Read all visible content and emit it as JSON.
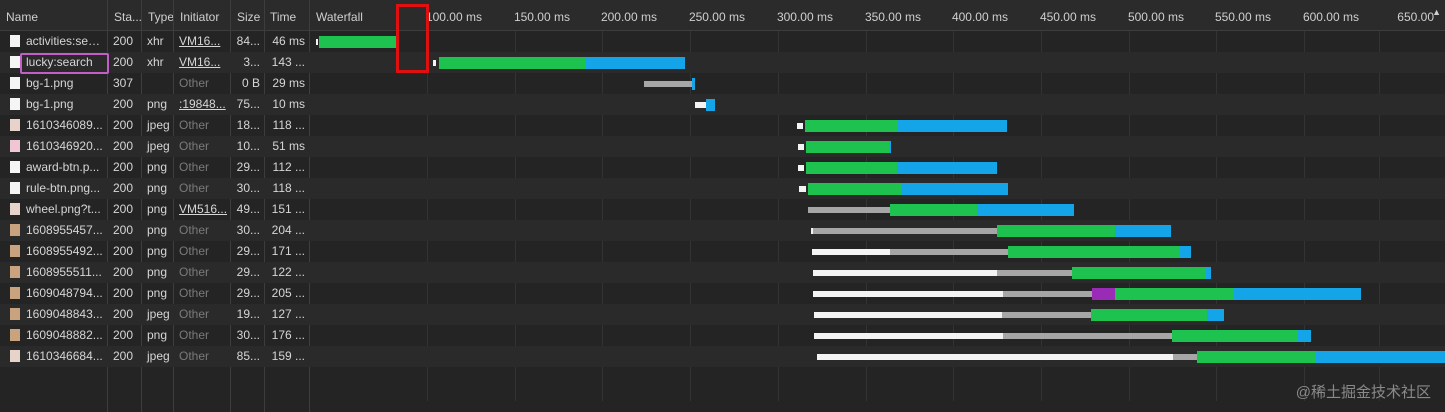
{
  "headers": {
    "name": "Name",
    "status": "Sta...",
    "type": "Type",
    "initiator": "Initiator",
    "size": "Size",
    "time": "Time",
    "waterfall": "Waterfall"
  },
  "ticks": [
    "100.00 ms",
    "150.00 ms",
    "200.00 ms",
    "250.00 ms",
    "300.00 ms",
    "350.00 ms",
    "400.00 ms",
    "450.00 ms",
    "500.00 ms",
    "550.00 ms",
    "600.00 ms",
    "650.00"
  ],
  "colors": {
    "green": "#1dc24f",
    "blue": "#14a4e8",
    "gray": "#a6a6a6",
    "white": "#f4f4f4",
    "purple": "#9a2bb6",
    "highlight_red": "#e01010",
    "highlight_pink": "#c45ec7"
  },
  "rows": [
    {
      "name": "activities:sea...",
      "status": "200",
      "type": "xhr",
      "initiator": "VM16...",
      "initiator_link": true,
      "size": "84...",
      "time": "46 ms",
      "icon": "file-icon",
      "bars": [
        [
          "white",
          316,
          318
        ],
        [
          "green",
          319,
          396
        ]
      ]
    },
    {
      "name": "lucky:search",
      "status": "200",
      "type": "xhr",
      "initiator": "VM16...",
      "initiator_link": true,
      "size": "3...",
      "time": "143 ...",
      "icon": "file-icon",
      "bars": [
        [
          "white",
          433,
          436
        ],
        [
          "green",
          439,
          586
        ],
        [
          "blue",
          586,
          685
        ]
      ]
    },
    {
      "name": "bg-1.png",
      "status": "307",
      "type": "",
      "initiator": "Other",
      "initiator_link": false,
      "size": "0 B",
      "time": "29 ms",
      "icon": "file-icon",
      "bars": [
        [
          "gray",
          644,
          692
        ],
        [
          "blue",
          692,
          695
        ]
      ]
    },
    {
      "name": "bg-1.png",
      "status": "200",
      "type": "png",
      "initiator": ":19848...",
      "initiator_link": true,
      "size": "75...",
      "time": "10 ms",
      "icon": "file-icon",
      "bars": [
        [
          "white",
          695,
          706
        ],
        [
          "blue",
          706,
          715
        ]
      ]
    },
    {
      "name": "1610346089...",
      "status": "200",
      "type": "jpeg",
      "initiator": "Other",
      "initiator_link": false,
      "size": "18...",
      "time": "118 ...",
      "icon": "image-icon",
      "bars": [
        [
          "white",
          797,
          803
        ],
        [
          "green",
          805,
          898
        ],
        [
          "blue",
          898,
          1007
        ]
      ]
    },
    {
      "name": "1610346920...",
      "status": "200",
      "type": "jpeg",
      "initiator": "Other",
      "initiator_link": false,
      "size": "10...",
      "time": "51 ms",
      "icon": "pink-image-icon",
      "bars": [
        [
          "white",
          798,
          804
        ],
        [
          "green",
          806,
          889
        ],
        [
          "blue",
          889,
          891
        ]
      ]
    },
    {
      "name": "award-btn.p...",
      "status": "200",
      "type": "png",
      "initiator": "Other",
      "initiator_link": false,
      "size": "29...",
      "time": "112 ...",
      "icon": "file-icon",
      "bars": [
        [
          "white",
          798,
          804
        ],
        [
          "green",
          806,
          897
        ],
        [
          "blue",
          897,
          997
        ]
      ]
    },
    {
      "name": "rule-btn.png...",
      "status": "200",
      "type": "png",
      "initiator": "Other",
      "initiator_link": false,
      "size": "30...",
      "time": "118 ...",
      "icon": "file-icon",
      "bars": [
        [
          "white",
          799,
          806
        ],
        [
          "green",
          808,
          901
        ],
        [
          "blue",
          901,
          1008
        ]
      ]
    },
    {
      "name": "wheel.png?t...",
      "status": "200",
      "type": "png",
      "initiator": "VM516...",
      "initiator_link": true,
      "size": "49...",
      "time": "151 ...",
      "icon": "image-icon",
      "bars": [
        [
          "gray",
          808,
          890
        ],
        [
          "green",
          890,
          977
        ],
        [
          "blue",
          977,
          1074
        ]
      ]
    },
    {
      "name": "1608955457...",
      "status": "200",
      "type": "png",
      "initiator": "Other",
      "initiator_link": false,
      "size": "30...",
      "time": "204 ...",
      "icon": "photo-icon",
      "bars": [
        [
          "white",
          811,
          813
        ],
        [
          "gray",
          813,
          997
        ],
        [
          "green",
          997,
          1115
        ],
        [
          "blue",
          1115,
          1171
        ]
      ]
    },
    {
      "name": "1608955492...",
      "status": "200",
      "type": "png",
      "initiator": "Other",
      "initiator_link": false,
      "size": "29...",
      "time": "171 ...",
      "icon": "photo-icon",
      "bars": [
        [
          "white",
          812,
          890
        ],
        [
          "gray",
          890,
          1008
        ],
        [
          "green",
          1008,
          1180
        ],
        [
          "blue",
          1180,
          1191
        ]
      ]
    },
    {
      "name": "1608955511...",
      "status": "200",
      "type": "png",
      "initiator": "Other",
      "initiator_link": false,
      "size": "29...",
      "time": "122 ...",
      "icon": "photo-icon",
      "bars": [
        [
          "white",
          813,
          997
        ],
        [
          "gray",
          997,
          1072
        ],
        [
          "green",
          1072,
          1206
        ],
        [
          "blue",
          1206,
          1211
        ]
      ]
    },
    {
      "name": "1609048794...",
      "status": "200",
      "type": "png",
      "initiator": "Other",
      "initiator_link": false,
      "size": "29...",
      "time": "205 ...",
      "icon": "photo-icon",
      "bars": [
        [
          "white",
          813,
          1003
        ],
        [
          "gray",
          1003,
          1092
        ],
        [
          "purple",
          1092,
          1115
        ],
        [
          "green",
          1115,
          1234
        ],
        [
          "blue",
          1234,
          1361
        ]
      ]
    },
    {
      "name": "1609048843...",
      "status": "200",
      "type": "jpeg",
      "initiator": "Other",
      "initiator_link": false,
      "size": "19...",
      "time": "127 ...",
      "icon": "photo-icon",
      "bars": [
        [
          "white",
          814,
          1002
        ],
        [
          "gray",
          1002,
          1091
        ],
        [
          "green",
          1091,
          1207
        ],
        [
          "blue",
          1207,
          1224
        ]
      ]
    },
    {
      "name": "1609048882...",
      "status": "200",
      "type": "png",
      "initiator": "Other",
      "initiator_link": false,
      "size": "30...",
      "time": "176 ...",
      "icon": "photo-icon",
      "bars": [
        [
          "white",
          814,
          1003
        ],
        [
          "gray",
          1003,
          1172
        ],
        [
          "green",
          1172,
          1298
        ],
        [
          "blue",
          1298,
          1311
        ]
      ]
    },
    {
      "name": "1610346684...",
      "status": "200",
      "type": "jpeg",
      "initiator": "Other",
      "initiator_link": false,
      "size": "85...",
      "time": "159 ...",
      "icon": "image-icon",
      "bars": [
        [
          "white",
          817,
          1173
        ],
        [
          "gray",
          1173,
          1197
        ],
        [
          "green",
          1197,
          1316
        ],
        [
          "blue",
          1316,
          1445
        ]
      ]
    }
  ],
  "watermark": "@稀土掘金技术社区"
}
